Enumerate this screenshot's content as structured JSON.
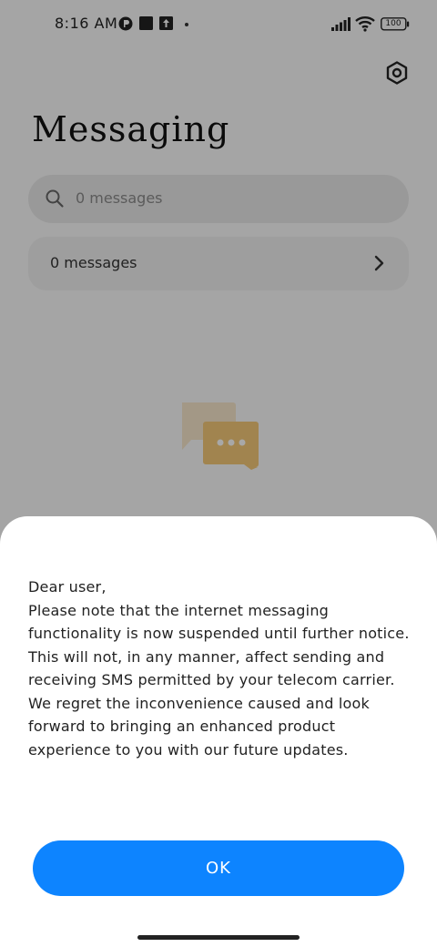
{
  "status_bar": {
    "time": "8:16 AM",
    "battery": "100",
    "icons": [
      "app-notification-icon",
      "square-notification-icon",
      "upload-notification-icon",
      "signal-icon",
      "wifi-icon",
      "battery-icon"
    ]
  },
  "header": {
    "title": "Messaging",
    "settings_icon": "gear-icon"
  },
  "search": {
    "placeholder": "0 messages"
  },
  "messages_row": {
    "label": "0 messages"
  },
  "dialog": {
    "message": "Dear user,\nPlease note that the internet messaging functionality is now suspended until further notice. This will not, in any manner, affect sending and receiving SMS permitted by your telecom carrier. We regret the inconvenience caused and look forward to bringing an enhanced product experience to you with our future updates.",
    "ok_label": "OK"
  },
  "colors": {
    "accent": "#0d84ff",
    "scrim": "rgba(0,0,0,0.34)",
    "sheet": "#ffffff"
  }
}
